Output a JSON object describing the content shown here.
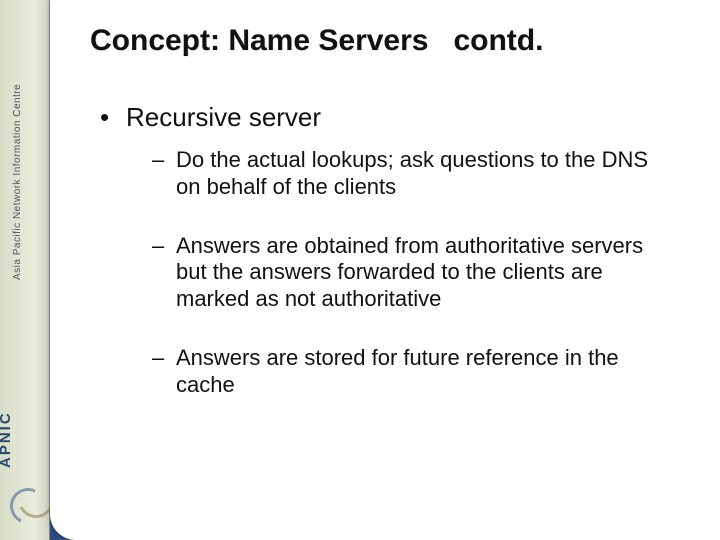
{
  "sidebar": {
    "org_text": "Asia Pacific Network Information Centre",
    "logo_text": "APNIC"
  },
  "slide": {
    "title": "Concept: Name Servers   contd.",
    "bullets": [
      {
        "label": "Recursive server",
        "sub": [
          "Do the actual lookups; ask questions to the DNS on behalf of the clients",
          "Answers are obtained from authoritative servers but the answers forwarded to the clients are marked as not authoritative",
          "Answers are stored for future reference in the cache"
        ]
      }
    ]
  }
}
